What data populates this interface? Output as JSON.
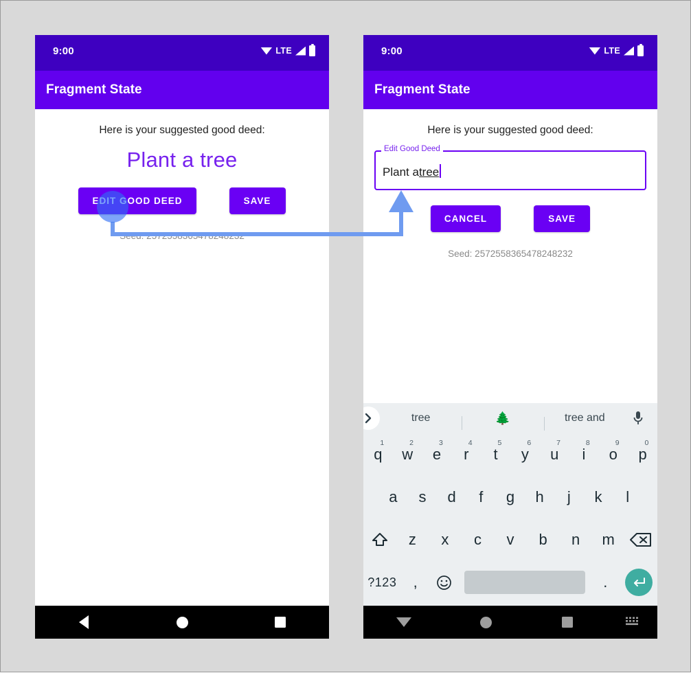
{
  "page": {
    "background_color": "#d9d9d9",
    "border_color": "#9a9a9a"
  },
  "colors": {
    "status_bar": "#3e00c0",
    "app_bar": "#6200ee",
    "primary_purple": "#6a00f4",
    "accent_text_purple": "#7722ee",
    "touch_indicator": "#2f6df6",
    "arrow": "#6f9bf0",
    "keyboard_bg": "#eceff1",
    "enter_key": "#3fada1",
    "nav_bar": "#000000"
  },
  "phones": [
    {
      "id": "left",
      "status_bar": {
        "time": "9:00",
        "network_label": "LTE",
        "icons": [
          "wifi-icon",
          "signal-icon",
          "battery-icon"
        ]
      },
      "app_bar": {
        "title": "Fragment State"
      },
      "content": {
        "prompt": "Here is your suggested good deed:",
        "deed": "Plant a tree",
        "buttons": [
          {
            "label": "EDIT GOOD DEED",
            "name": "edit-good-deed-button"
          },
          {
            "label": "SAVE",
            "name": "save-button"
          }
        ],
        "seed": "Seed: 2572558365478248232"
      },
      "nav_bar": {
        "items": [
          "back-icon",
          "home-icon",
          "recents-icon"
        ]
      }
    },
    {
      "id": "right",
      "status_bar": {
        "time": "9:00",
        "network_label": "LTE",
        "icons": [
          "wifi-icon",
          "signal-icon",
          "battery-icon"
        ]
      },
      "app_bar": {
        "title": "Fragment State"
      },
      "content": {
        "prompt": "Here is your suggested good deed:",
        "textfield": {
          "label": "Edit Good Deed",
          "value_prefix": "Plant a ",
          "value_composing": "tree",
          "full_value": "Plant a tree"
        },
        "buttons": [
          {
            "label": "CANCEL",
            "name": "cancel-button"
          },
          {
            "label": "SAVE",
            "name": "save-button"
          }
        ],
        "seed": "Seed: 2572558365478248232"
      },
      "keyboard": {
        "suggestions": [
          {
            "text": "tree",
            "kind": "word"
          },
          {
            "text": "🌲",
            "kind": "emoji"
          },
          {
            "text": "tree and",
            "kind": "word"
          }
        ],
        "expand_icon": "chevron-right-icon",
        "mic_icon": "microphone-icon",
        "row1": [
          {
            "key": "q",
            "num": "1"
          },
          {
            "key": "w",
            "num": "2"
          },
          {
            "key": "e",
            "num": "3"
          },
          {
            "key": "r",
            "num": "4"
          },
          {
            "key": "t",
            "num": "5"
          },
          {
            "key": "y",
            "num": "6"
          },
          {
            "key": "u",
            "num": "7"
          },
          {
            "key": "i",
            "num": "8"
          },
          {
            "key": "o",
            "num": "9"
          },
          {
            "key": "p",
            "num": "0"
          }
        ],
        "row2": [
          "a",
          "s",
          "d",
          "f",
          "g",
          "h",
          "j",
          "k",
          "l"
        ],
        "row3": {
          "shift_icon": "shift-icon",
          "keys": [
            "z",
            "x",
            "c",
            "v",
            "b",
            "n",
            "m"
          ],
          "backspace_icon": "backspace-icon"
        },
        "row4": {
          "symbols_label": "?123",
          "comma": ",",
          "emoji_icon": "emoji-icon",
          "space_label": "",
          "period": ".",
          "enter_icon": "enter-icon"
        }
      },
      "nav_bar": {
        "items": [
          "hide-keyboard-icon",
          "home-icon",
          "recents-icon",
          "keyboard-icon"
        ]
      }
    }
  ],
  "annotation": {
    "touch_indicator_label": "tap-on-edit-good-deed",
    "arrow_label": "flow-arrow-to-textfield"
  }
}
